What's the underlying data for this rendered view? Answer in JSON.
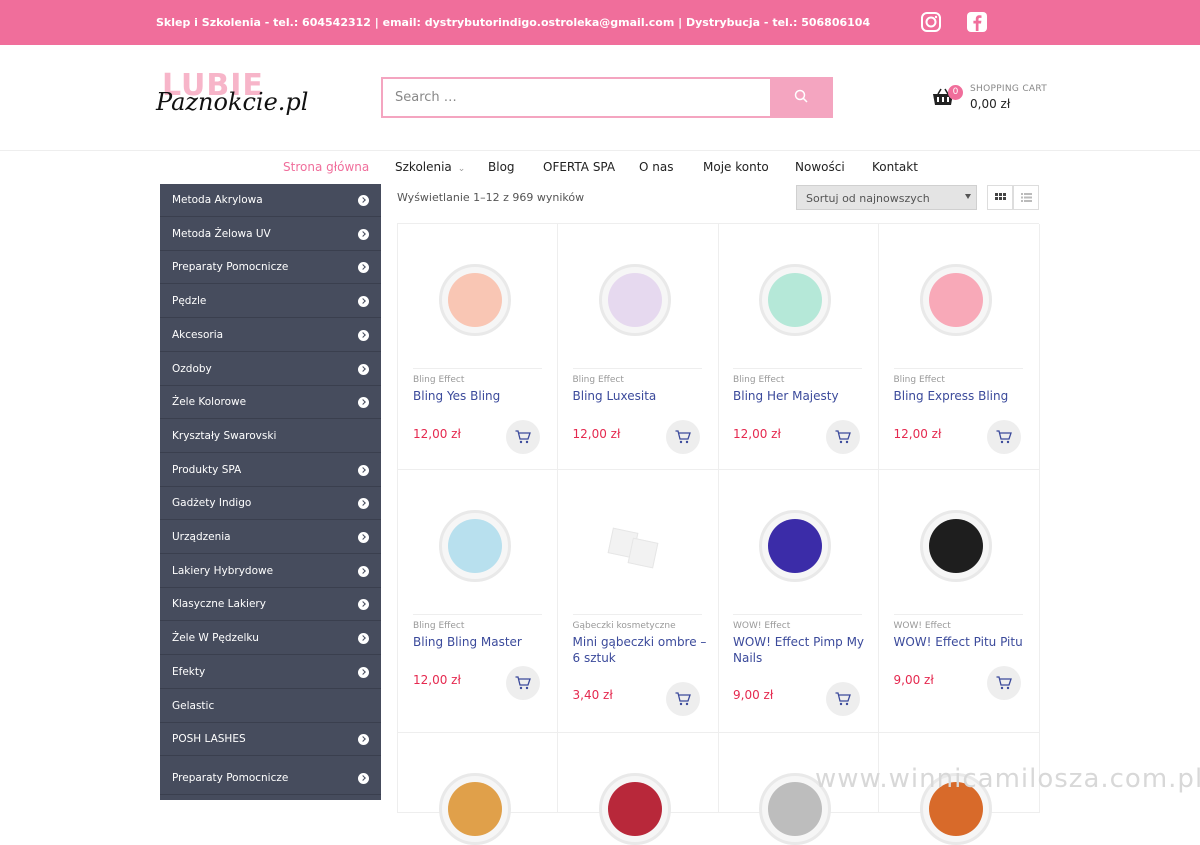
{
  "topbar": {
    "contact": "Sklep i Szkolenia - tel.: 604542312 | email: dystrybutorindigo.ostroleka@gmail.com | Dystrybucja - tel.: 506806104",
    "social": [
      "instagram-icon",
      "facebook-icon"
    ],
    "bg_color": "#f06e9b"
  },
  "logo": {
    "line1": "LUBIE",
    "line2": "Paznokcie.pl"
  },
  "search": {
    "placeholder": "Search …",
    "button_icon": "search-icon"
  },
  "cart": {
    "count": "0",
    "label": "SHOPPING CART",
    "amount": "0,00 zł"
  },
  "nav": {
    "items": [
      "Strona główna",
      "Szkolenia",
      "Blog",
      "OFERTA SPA",
      "O nas",
      "Moje konto",
      "Nowości",
      "Kontakt"
    ],
    "active": "Strona główna"
  },
  "sidebar": {
    "items": [
      {
        "label": "Metoda Akrylowa",
        "arrow": true
      },
      {
        "label": "Metoda Żelowa UV",
        "arrow": true
      },
      {
        "label": "Preparaty Pomocnicze",
        "arrow": true
      },
      {
        "label": "Pędzle",
        "arrow": true
      },
      {
        "label": "Akcesoria",
        "arrow": true
      },
      {
        "label": "Ozdoby",
        "arrow": true
      },
      {
        "label": "Żele Kolorowe",
        "arrow": true
      },
      {
        "label": "Kryształy Swarovski",
        "arrow": false
      },
      {
        "label": "Produkty SPA",
        "arrow": true
      },
      {
        "label": "Gadżety Indigo",
        "arrow": true
      },
      {
        "label": "Urządzenia",
        "arrow": true
      },
      {
        "label": "Lakiery Hybrydowe",
        "arrow": true
      },
      {
        "label": "Klasyczne Lakiery",
        "arrow": true
      },
      {
        "label": "Żele W Pędzelku",
        "arrow": true
      },
      {
        "label": "Efekty",
        "arrow": true
      },
      {
        "label": "Gelastic",
        "arrow": false
      },
      {
        "label": "POSH LASHES",
        "arrow": true
      },
      {
        "label": "Preparaty Pomocnicze",
        "arrow": true
      }
    ]
  },
  "results": "Wyświetlanie 1–12 z 969 wyników",
  "sort": {
    "selected": "Sortuj od najnowszych"
  },
  "products": [
    {
      "category": "Bling Effect",
      "name": "Bling Yes Bling",
      "price": "12,00 zł",
      "color": "#f9c6b4"
    },
    {
      "category": "Bling Effect",
      "name": "Bling Luxesita",
      "price": "12,00 zł",
      "color": "#e6d9ef"
    },
    {
      "category": "Bling Effect",
      "name": "Bling Her Majesty",
      "price": "12,00 zł",
      "color": "#b5e8d8"
    },
    {
      "category": "Bling Effect",
      "name": "Bling Express Bling",
      "price": "12,00 zł",
      "color": "#f8a9b8"
    },
    {
      "category": "Bling Effect",
      "name": "Bling Bling Master",
      "price": "12,00 zł",
      "color": "#b8e0ee"
    },
    {
      "category": "Gąbeczki kosmetyczne",
      "name": "Mini gąbeczki ombre – 6 sztuk",
      "price": "3,40 zł",
      "color": "#f4f4f4"
    },
    {
      "category": "WOW! Effect",
      "name": "WOW! Effect Pimp My Nails",
      "price": "9,00 zł",
      "color": "#3b2ca8"
    },
    {
      "category": "WOW! Effect",
      "name": "WOW! Effect Pitu Pitu",
      "price": "9,00 zł",
      "color": "#1e1e1e"
    },
    {
      "category": "",
      "name": "",
      "price": "",
      "color": "#e0a04a"
    },
    {
      "category": "",
      "name": "",
      "price": "",
      "color": "#b8283a"
    },
    {
      "category": "",
      "name": "",
      "price": "",
      "color": "#bdbdbd"
    },
    {
      "category": "",
      "name": "",
      "price": "",
      "color": "#d86a2a"
    }
  ],
  "watermark": "www.winnicamilosza.com.pl",
  "colors": {
    "accent": "#f06e9b",
    "sidebar": "#464c5d",
    "price": "#e5294f",
    "link": "#3b4a9b"
  }
}
